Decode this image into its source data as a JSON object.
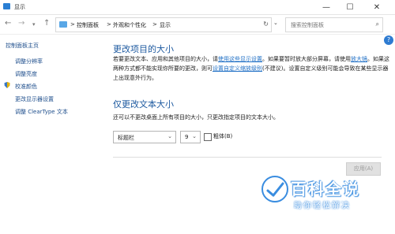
{
  "window": {
    "title": "显示"
  },
  "address": {
    "crumbs": [
      "控制面板",
      "外观和个性化",
      "显示"
    ],
    "separators": [
      ">",
      ">",
      ">"
    ],
    "search_placeholder": "搜索控制面板"
  },
  "sidebar": {
    "items": [
      {
        "label": "控制面板主页"
      },
      {
        "label": "调整分辨率"
      },
      {
        "label": "调整亮度"
      },
      {
        "label": "校准颜色"
      },
      {
        "label": "更改显示器设置"
      },
      {
        "label": "调整 ClearType 文本"
      }
    ]
  },
  "main": {
    "section1": {
      "title": "更改项目的大小",
      "p1": "若要更改文本、应用和其他项目的大小，请",
      "link1": "使用这些显示设置",
      "p2": "。如果要暂时放大部分屏幕，请使用",
      "link2": "放大镜",
      "p3": "。如果这两种方式都不能实现你所要的更改，则可",
      "link3": "设置自定义缩放级别",
      "p4": "(不建议)。设置自定义级别可能会导致在某些显示器上出现意外行为。"
    },
    "section2": {
      "title": "仅更改文本大小",
      "desc": "还可以不更改桌面上所有项目的大小，只更改指定项目的文本大小。",
      "item_select": "标题栏",
      "size_select": "9",
      "bold_label": "粗体(B)",
      "bold_checked": false
    },
    "apply_label": "应用(A)"
  },
  "watermark": {
    "main": "百科全说",
    "sub": "助你轻松解决"
  },
  "colors": {
    "heading": "#1e5aa0",
    "link": "#1f6fc5",
    "accent": "#2e7bd1"
  }
}
